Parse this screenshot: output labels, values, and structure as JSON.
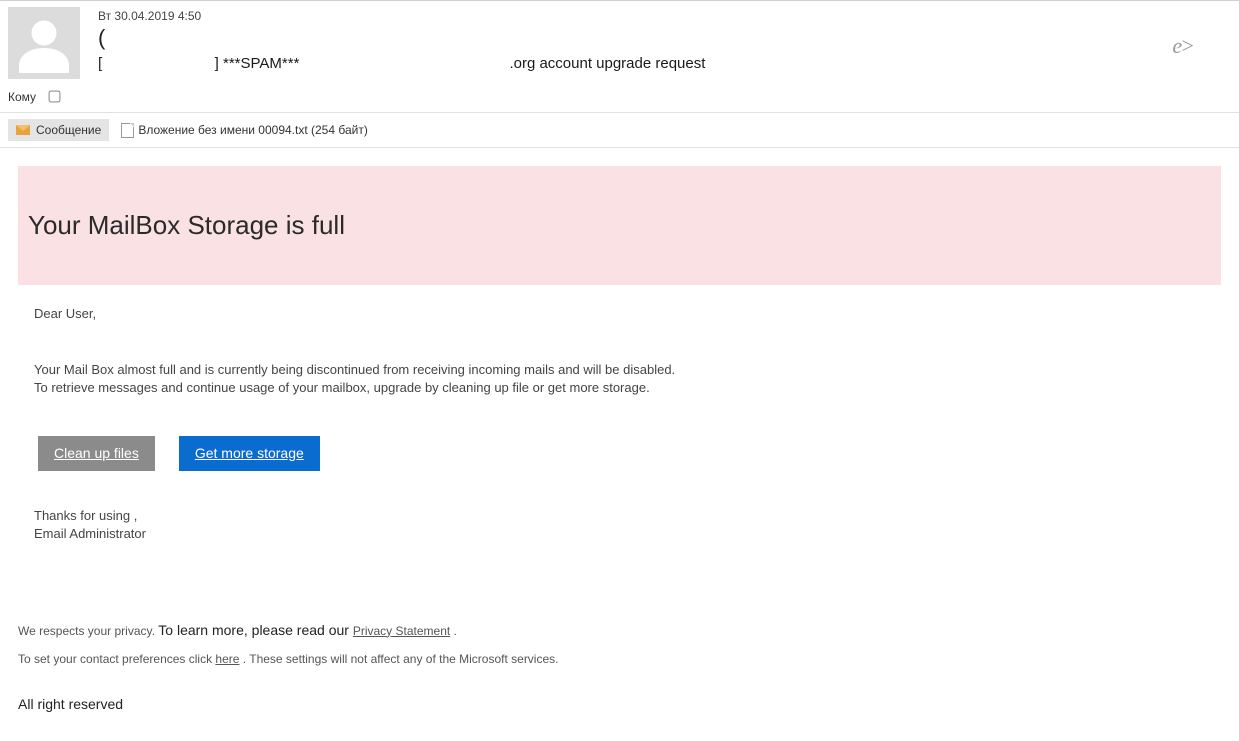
{
  "header": {
    "date": "Вт 30.04.2019 4:50",
    "paren": "(",
    "subject_prefix": "[",
    "subject_mid": "] ***SPAM***",
    "subject_suffix": ".org account upgrade request",
    "reply_glyph": "e>",
    "to_label": "Кому"
  },
  "tabs": {
    "message_label": "Сообщение",
    "attachment_label": "Вложение без имени 00094.txt (254 байт)"
  },
  "body": {
    "alert_title": "Your MailBox Storage is full",
    "greeting": "Dear User,",
    "para1": "Your Mail Box almost full and is currently being discontinued from receiving incoming mails and will be disabled.",
    "para2": "To retrieve messages and continue usage of your mailbox, upgrade by cleaning up file or get more storage.",
    "btn_clean": "Clean up files",
    "btn_storage": "Get   more storage",
    "thanks": "Thanks for using ,",
    "signature": "Email Administrator"
  },
  "footer": {
    "privacy_small_prefix": "We respects your privacy. ",
    "privacy_mid": "To learn more, please read our ",
    "privacy_link": "Privacy Statement",
    "privacy_tail": " .",
    "prefs_prefix": "To set your contact preferences click ",
    "prefs_link": "here",
    "prefs_tail": " . These settings will not affect any of the Microsoft services.",
    "reserved": "All right reserved"
  }
}
